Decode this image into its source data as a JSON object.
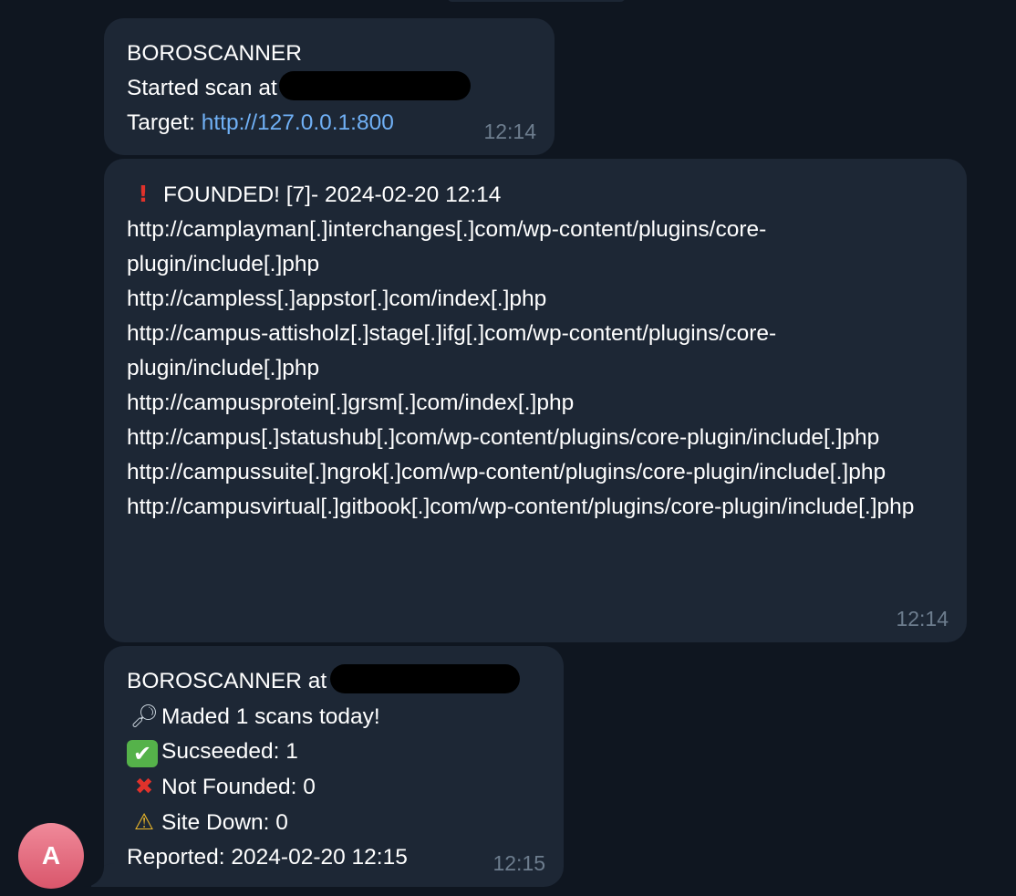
{
  "colors": {
    "background": "#0f1620",
    "bubble": "#1d2735",
    "link": "#70b0f5",
    "timestamp": "#6d7d8e",
    "avatar": "#e06a7c"
  },
  "messages": [
    {
      "lines": {
        "title": "BOROSCANNER",
        "started": "Started scan at",
        "target_label": "Target: ",
        "target_link": "http://127.0.0.1:800"
      },
      "time": "12:14"
    },
    {
      "icon": "exclamation-icon",
      "header": "FOUNDED! [7]- 2024-02-20 12:14",
      "urls": [
        "http://camplayman[.]interchanges[.]com/wp-content/plugins/core-plugin/include[.]php",
        "http://campless[.]appstor[.]com/index[.]php",
        "http://campus-attisholz[.]stage[.]ifg[.]com/wp-content/plugins/core-plugin/include[.]php",
        "http://campusprotein[.]grsm[.]com/index[.]php",
        "http://campus[.]statushub[.]com/wp-content/plugins/core-plugin/include[.]php",
        "http://campussuite[.]ngrok[.]com/wp-content/plugins/core-plugin/include[.]php",
        "http://campusvirtual[.]gitbook[.]com/wp-content/plugins/core-plugin/include[.]php"
      ],
      "time": "12:14"
    },
    {
      "lines": {
        "title": "BOROSCANNER at",
        "scans": "Maded 1 scans today!",
        "succeeded": "Sucseeded: 1",
        "not_found": "Not Founded: 0",
        "site_down": "Site Down: 0",
        "reported": "Reported: 2024-02-20 12:15"
      },
      "icons": [
        "magnifying-glass-icon",
        "check-mark-icon",
        "cross-mark-icon",
        "warning-icon"
      ],
      "time": "12:15"
    }
  ],
  "sender": {
    "avatar_initial": "A"
  }
}
